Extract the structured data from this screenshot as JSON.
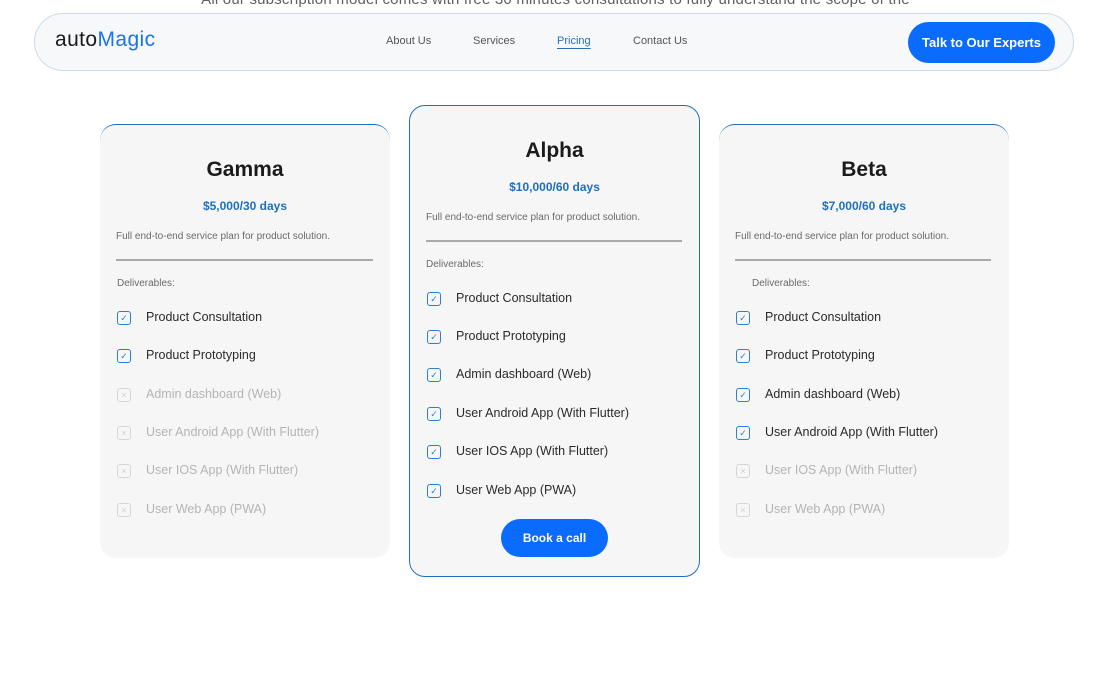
{
  "page": {
    "top_text": "All our subscription model comes with free 30 minutes consultations to fully understand the scope of the"
  },
  "header": {
    "logo_part1": "auto",
    "logo_part2": "Magic",
    "nav": [
      "About Us",
      "Services",
      "Pricing",
      "Contact Us"
    ],
    "active_nav": "Pricing",
    "cta_label": "Talk to Our Experts"
  },
  "colors": {
    "accent": "#0a6cff",
    "brand_text": "#1a73e8",
    "card_border": "#1e6fc0",
    "card_bg": "#f6f6f6"
  },
  "plans": [
    {
      "name": "Gamma",
      "price": "$5,000/30 days",
      "description": "Full end-to-end service plan for product solution.",
      "deliverables_label": "Deliverables:",
      "features": [
        {
          "label": "Product Consultation",
          "included": true
        },
        {
          "label": "Product Prototyping",
          "included": true
        },
        {
          "label": "Admin dashboard (Web)",
          "included": false
        },
        {
          "label": "User Android App (With Flutter)",
          "included": false
        },
        {
          "label": "User IOS App (With Flutter)",
          "included": false
        },
        {
          "label": "User Web App (PWA)",
          "included": false
        }
      ]
    },
    {
      "name": "Alpha",
      "price": "$10,000/60 days",
      "description": "Full end-to-end service plan for product solution.",
      "deliverables_label": "Deliverables:",
      "features": [
        {
          "label": "Product Consultation",
          "included": true
        },
        {
          "label": "Product Prototyping",
          "included": true
        },
        {
          "label": "Admin dashboard (Web)",
          "included": true
        },
        {
          "label": "User Android App (With Flutter)",
          "included": true
        },
        {
          "label": "User IOS App (With Flutter)",
          "included": true
        },
        {
          "label": "User Web App (PWA)",
          "included": true
        }
      ],
      "button_label": "Book a call"
    },
    {
      "name": "Beta",
      "price": "$7,000/60 days",
      "description": "Full end-to-end service plan for product solution.",
      "deliverables_label": "Deliverables:",
      "features": [
        {
          "label": "Product Consultation",
          "included": true
        },
        {
          "label": "Product Prototyping",
          "included": true
        },
        {
          "label": "Admin dashboard (Web)",
          "included": true
        },
        {
          "label": "User Android App (With Flutter)",
          "included": true
        },
        {
          "label": "User IOS App (With Flutter)",
          "included": false
        },
        {
          "label": "User Web App (PWA)",
          "included": false
        }
      ]
    }
  ]
}
